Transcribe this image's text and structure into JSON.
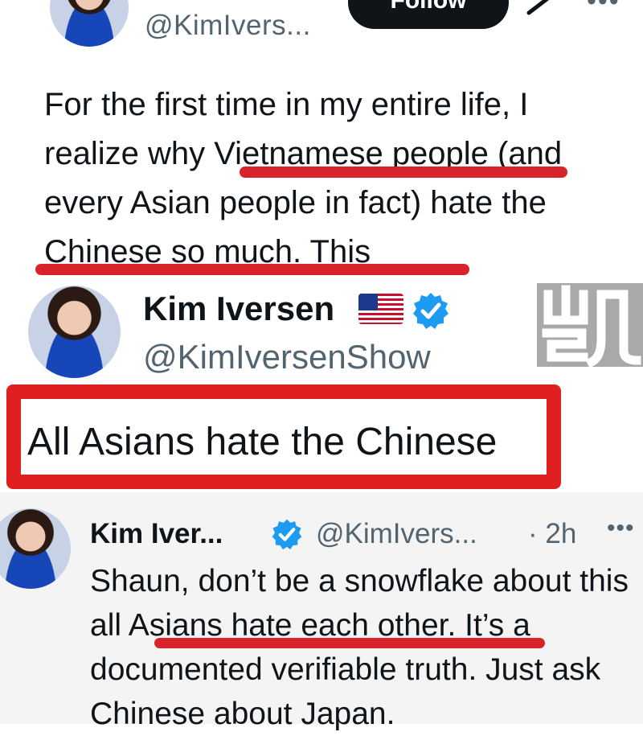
{
  "top_tweet": {
    "handle": "@KimIvers...",
    "follow_label": "Follow",
    "text": "For the first time in my entire life, I realize why Vietnamese people (and every Asian people in fact) hate the Chinese so much. This"
  },
  "middle_profile": {
    "display_name": "Kim Iversen",
    "flag": "🇺🇸",
    "handle": "@KimIversenShow",
    "quote": "All Asians hate the Chinese",
    "watermark_char": "凯"
  },
  "reply_tweet": {
    "display_name": "Kim Iver...",
    "handle": "@KimIvers...",
    "time": "· 2h",
    "more": "•••",
    "text": "Shaun, don’t be a snowflake about this all Asians hate each other. It’s a documented verifiable truth. Just ask Chinese about Japan."
  },
  "colors": {
    "highlight_red": "#d9232a",
    "verified_blue": "#1d9bf0",
    "text_primary": "#0f1419",
    "text_secondary": "#536471"
  },
  "icons": [
    "grok-icon",
    "more-icon",
    "verified-badge-icon",
    "us-flag-icon",
    "avatar"
  ]
}
